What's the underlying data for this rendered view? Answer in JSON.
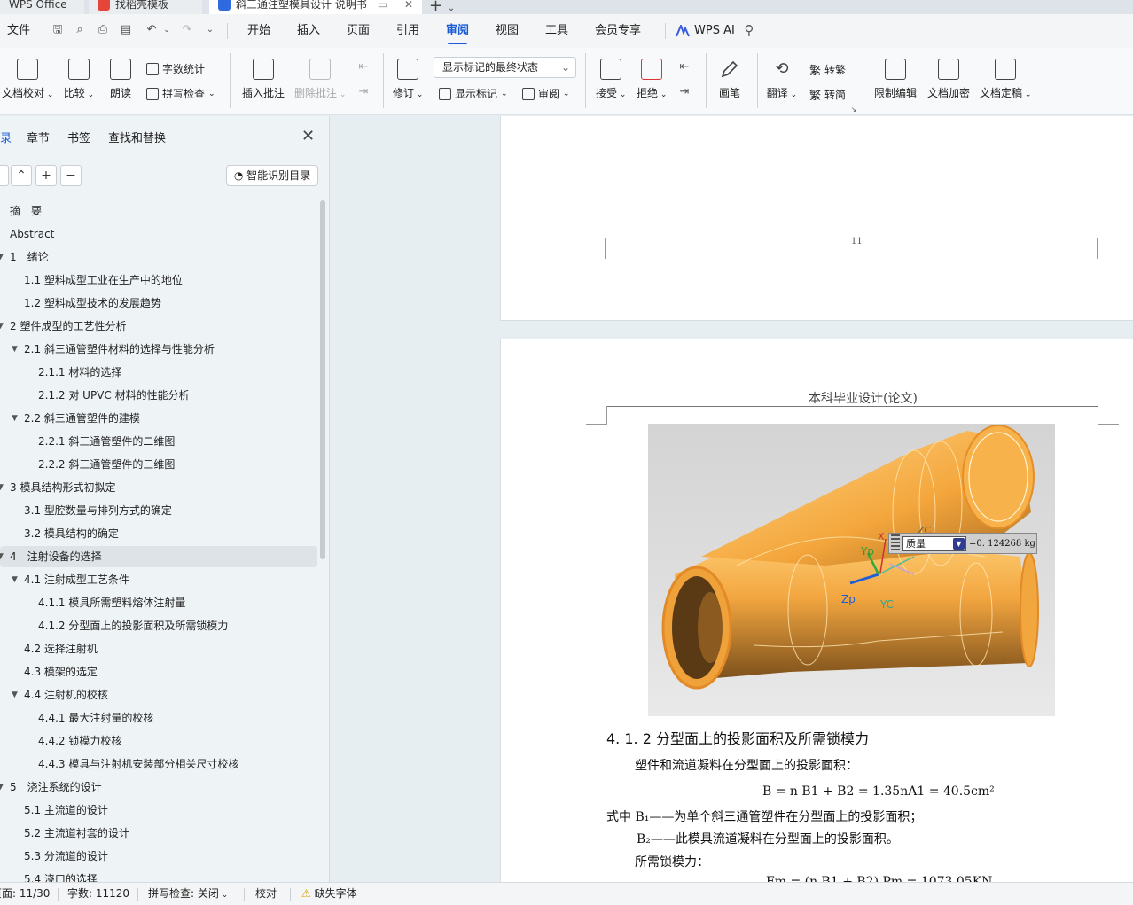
{
  "tabs": [
    {
      "label": "WPS Office"
    },
    {
      "label": "找稻壳模板"
    },
    {
      "label": "斜三通注塑模具设计 说明书"
    }
  ],
  "menu": {
    "file": "文件",
    "items": [
      "开始",
      "插入",
      "页面",
      "引用",
      "审阅",
      "视图",
      "工具",
      "会员专享"
    ],
    "active": "审阅",
    "ai": "WPS AI"
  },
  "ribbon": {
    "doc_proof": "文档校对",
    "compare": "比较",
    "read_aloud": "朗读",
    "word_count": "字数统计",
    "spell_check": "拼写检查",
    "insert_comment": "插入批注",
    "delete_comment": "删除批注",
    "track_changes": "修订",
    "markup_mode": "显示标记的最终状态",
    "show_markup": "显示标记",
    "review": "审阅",
    "accept": "接受",
    "reject": "拒绝",
    "pen": "画笔",
    "translate": "翻译",
    "to_traditional": "转繁",
    "to_simplified": "转简",
    "restrict_edit": "限制编辑",
    "encrypt": "文档加密",
    "finalize": "文档定稿"
  },
  "nav": {
    "tabs": [
      "录",
      "章节",
      "书签",
      "查找和替换"
    ],
    "ai_toc_button": "智能识别目录",
    "items": [
      {
        "label": "摘　要",
        "level": 1,
        "toggle": false
      },
      {
        "label": "Abstract",
        "level": 1,
        "toggle": false
      },
      {
        "label": "1　绪论",
        "level": 1,
        "toggle": true
      },
      {
        "label": "1.1  塑料成型工业在生产中的地位",
        "level": 2,
        "toggle": false
      },
      {
        "label": "1.2  塑料成型技术的发展趋势",
        "level": 2,
        "toggle": false
      },
      {
        "label": "2 塑件成型的工艺性分析",
        "level": 1,
        "toggle": true
      },
      {
        "label": "2.1 斜三通管塑件材料的选择与性能分析",
        "level": 2,
        "toggle": true
      },
      {
        "label": "2.1.1 材料的选择",
        "level": 3,
        "toggle": false
      },
      {
        "label": "2.1.2  对 UPVC 材料的性能分析",
        "level": 3,
        "toggle": false
      },
      {
        "label": "2.2 斜三通管塑件的建模",
        "level": 2,
        "toggle": true
      },
      {
        "label": "2.2.1 斜三通管塑件的二维图",
        "level": 3,
        "toggle": false
      },
      {
        "label": "2.2.2 斜三通管塑件的三维图",
        "level": 3,
        "toggle": false
      },
      {
        "label": "3 模具结构形式初拟定",
        "level": 1,
        "toggle": true
      },
      {
        "label": "3.1 型腔数量与排列方式的确定",
        "level": 2,
        "toggle": false
      },
      {
        "label": "3.2 模具结构的确定",
        "level": 2,
        "toggle": false
      },
      {
        "label": "4　注射设备的选择",
        "level": 1,
        "toggle": true,
        "selected": true
      },
      {
        "label": "4.1  注射成型工艺条件",
        "level": 2,
        "toggle": true
      },
      {
        "label": "4.1.1  模具所需塑料熔体注射量",
        "level": 3,
        "toggle": false
      },
      {
        "label": "4.1.2  分型面上的投影面积及所需锁模力",
        "level": 3,
        "toggle": false
      },
      {
        "label": "4.2  选择注射机",
        "level": 2,
        "toggle": false
      },
      {
        "label": "4.3  模架的选定",
        "level": 2,
        "toggle": false
      },
      {
        "label": "4.4  注射机的校核",
        "level": 2,
        "toggle": true
      },
      {
        "label": "4.4.1  最大注射量的校核",
        "level": 3,
        "toggle": false
      },
      {
        "label": "4.4.2  锁模力校核",
        "level": 3,
        "toggle": false
      },
      {
        "label": "4.4.3  模具与注射机安装部分相关尺寸校核",
        "level": 3,
        "toggle": false
      },
      {
        "label": "5　浇注系统的设计",
        "level": 1,
        "toggle": true
      },
      {
        "label": "5.1  主流道的设计",
        "level": 2,
        "toggle": false
      },
      {
        "label": "5.2  主流道衬套的设计",
        "level": 2,
        "toggle": false
      },
      {
        "label": "5.3  分流道的设计",
        "level": 2,
        "toggle": false
      },
      {
        "label": "5.4  浇口的选择",
        "level": 2,
        "toggle": false
      }
    ]
  },
  "document": {
    "page_number": "11",
    "header": "本科毕业设计(论文)",
    "cad": {
      "mass_select": "质量",
      "mass_value": "=0. 124268  kg",
      "axis_x": "X",
      "axis_zc": "ZC",
      "axis_yp": "Yp",
      "axis_zp": "Zp",
      "axis_yc": "YC"
    },
    "heading": "4. 1. 2  分型面上的投影面积及所需锁模力",
    "p1": "塑件和流道凝料在分型面上的投影面积：",
    "formula1": "B = n B1 + B2 = 1.35nA1 = 40.5cm²",
    "p2": "式中 B₁——为单个斜三通管塑件在分型面上的投影面积；",
    "p3": "B₂——此模具流道凝料在分型面上的投影面积。",
    "p4": "所需锁模力：",
    "formula2": "Fm = (n B1 + B2) Pm = 1073.05KN"
  },
  "status": {
    "page": "页面: 11/30",
    "words": "字数: 11120",
    "spell": "拼写检查: 关闭",
    "proof": "校对",
    "missing_font": "缺失字体"
  },
  "colors": {
    "accent": "#1a5bd6",
    "pipe": "#f0a23a"
  }
}
